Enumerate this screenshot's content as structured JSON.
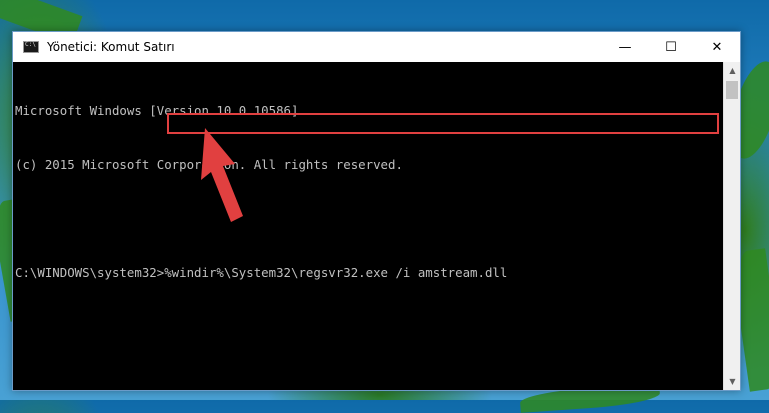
{
  "window": {
    "title": "Yönetici: Komut Satırı",
    "controls": {
      "minimize": "—",
      "maximize": "☐",
      "close": "✕"
    }
  },
  "console": {
    "lines": [
      "Microsoft Windows [Version 10.0.10586]",
      "(c) 2015 Microsoft Corporotion. All rights reserved.",
      "",
      "C:\\WINDOWS\\system32>%windir%\\System32\\regsvr32.exe /i amstream.dll"
    ]
  },
  "colors": {
    "console_bg": "#000000",
    "console_text": "#c0c0c0",
    "highlight_border": "#e14040",
    "pointer_arrow": "#e14040"
  },
  "icons": {
    "app": "cmd-icon",
    "pointer": "red-pointer-arrow"
  }
}
